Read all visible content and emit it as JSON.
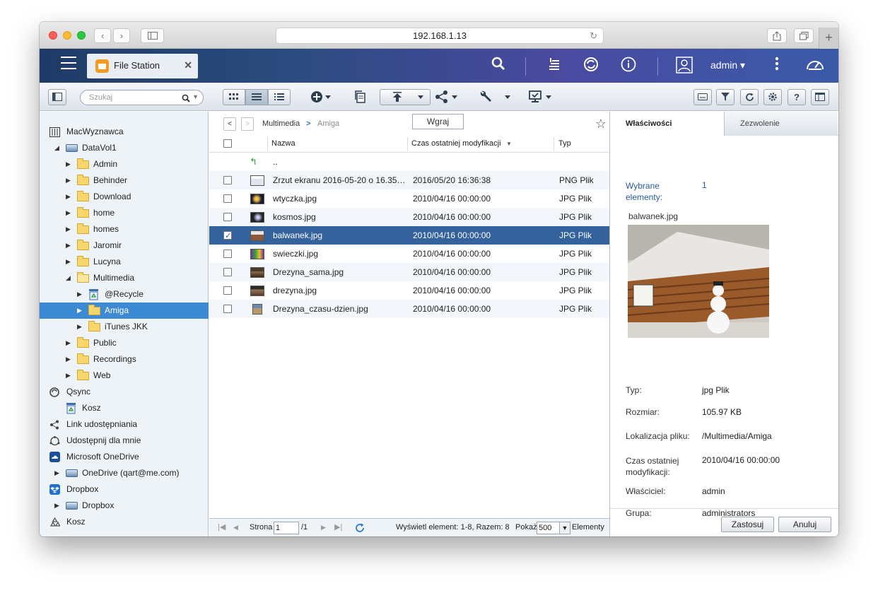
{
  "browser": {
    "url": "192.168.1.13",
    "reload_icon": "reload-icon"
  },
  "header": {
    "app_tab_label": "File Station",
    "user_label": "admin ▾"
  },
  "toolbar": {
    "search_placeholder": "Szukaj"
  },
  "tree": {
    "root": "MacWyznawca",
    "volume": "DataVol1",
    "folders": [
      "Admin",
      "Behinder",
      "Download",
      "home",
      "homes",
      "Jaromir",
      "Lucyna",
      "Multimedia"
    ],
    "multimedia_children": [
      "@Recycle",
      "Amiga",
      "iTunes JKK"
    ],
    "after_folders": [
      "Public",
      "Recordings",
      "Web"
    ],
    "qsync": "Qsync",
    "qsync_trash": "Kosz",
    "share_link": "Link udostępniania",
    "shared_with_me": "Udostępnij dla mnie",
    "onedrive": "Microsoft OneDrive",
    "onedrive_account": "OneDrive (qart@me.com)",
    "dropbox": "Dropbox",
    "dropbox_account": "Dropbox",
    "trash": "Kosz"
  },
  "center": {
    "breadcrumb_parent": "Multimedia",
    "breadcrumb_current": "Amiga",
    "upload_tooltip": "Wgraj",
    "columns": {
      "name": "Nazwa",
      "modified": "Czas ostatniej modyfikacji",
      "type": "Typ"
    },
    "parent_row": "..",
    "files": [
      {
        "name": "Zrzut ekranu 2016-05-20 o 16.35.…",
        "date": "2016/05/20 16:36:38",
        "type": "PNG Plik"
      },
      {
        "name": "wtyczka.jpg",
        "date": "2010/04/16 00:00:00",
        "type": "JPG Plik"
      },
      {
        "name": "kosmos.jpg",
        "date": "2010/04/16 00:00:00",
        "type": "JPG Plik"
      },
      {
        "name": "balwanek.jpg",
        "date": "2010/04/16 00:00:00",
        "type": "JPG Plik"
      },
      {
        "name": "swieczki.jpg",
        "date": "2010/04/16 00:00:00",
        "type": "JPG Plik"
      },
      {
        "name": "Drezyna_sama.jpg",
        "date": "2010/04/16 00:00:00",
        "type": "JPG Plik"
      },
      {
        "name": "drezyna.jpg",
        "date": "2010/04/16 00:00:00",
        "type": "JPG Plik"
      },
      {
        "name": "Drezyna_czasu-dzien.jpg",
        "date": "2010/04/16 00:00:00",
        "type": "JPG Plik"
      }
    ],
    "status": {
      "page_label": "Strona",
      "page_value": "1",
      "page_total": "/1",
      "summary": "Wyświetl element: 1-8, Razem: 8",
      "show_label": "Pokaż",
      "show_value": "500",
      "items_label": "Elementy"
    }
  },
  "details": {
    "tab_properties": "Właściwości",
    "tab_permissions": "Zezwolenie",
    "selected_label": "Wybrane elementy:",
    "selected_count": "1",
    "selected_name": "balwanek.jpg",
    "type_label": "Typ:",
    "type_value": "jpg Plik",
    "size_label": "Rozmiar:",
    "size_value": "105.97 KB",
    "location_label": "Lokalizacja pliku:",
    "location_value": "/Multimedia/Amiga",
    "modified_label": "Czas ostatniej modyfikacji:",
    "modified_value": "2010/04/16 00:00:00",
    "owner_label": "Właściciel:",
    "owner_value": "admin",
    "group_label": "Grupa:",
    "group_value": "administrators",
    "apply_button": "Zastosuj",
    "cancel_button": "Anuluj"
  }
}
